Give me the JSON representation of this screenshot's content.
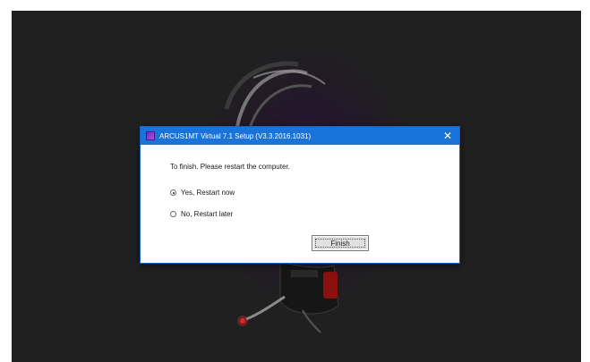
{
  "dialog": {
    "title": "ARCUS1MT Virtual 7.1 Setup (V3.3.2016.1031)",
    "close_glyph": "✕",
    "message": "To finish. Please restart the computer.",
    "options": [
      {
        "label": "Yes, Restart now",
        "checked": true
      },
      {
        "label": "No, Restart later",
        "checked": false
      }
    ],
    "finish_label": "Finish"
  },
  "colors": {
    "titlebar": "#1a73d9",
    "backdrop": "#202020",
    "accent_glow": "#3a1c4a"
  },
  "icons": {
    "app": "setup-app-icon",
    "close": "close-icon"
  }
}
